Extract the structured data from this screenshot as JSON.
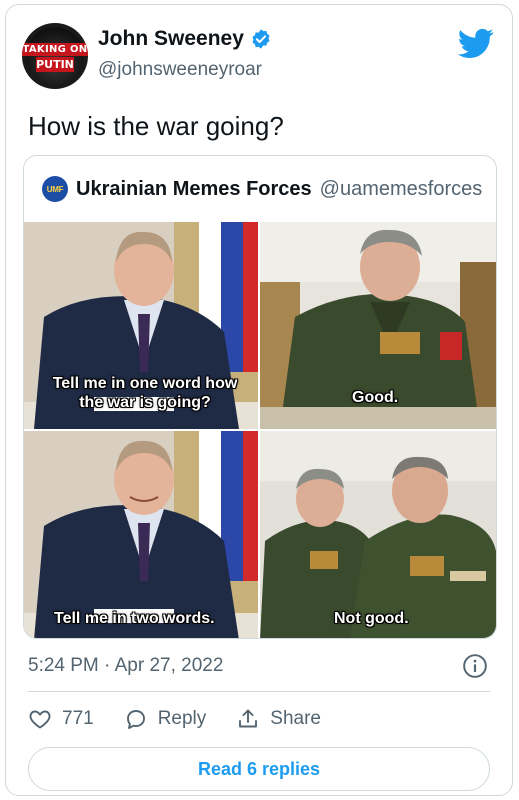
{
  "author": {
    "name": "John Sweeney",
    "handle": "@johnsweeneyroar",
    "avatar_text_line1": "TAKING ON",
    "avatar_text_line2": "PUTIN",
    "verified": true
  },
  "tweet": {
    "text": "How is the war going?",
    "timestamp": "5:24 PM · Apr 27, 2022"
  },
  "quoted": {
    "name": "Ukrainian Memes Forces",
    "handle": "@uamemesforces",
    "avatar_text": "UMF",
    "meme": {
      "top_left_caption": "Tell me in one word how the war is going?",
      "top_right_caption": "Good.",
      "bottom_left_caption": "Tell me in two words.",
      "bottom_right_caption": "Not good."
    }
  },
  "engagement": {
    "likes": "771",
    "reply_label": "Reply",
    "share_label": "Share"
  },
  "read_replies_label": "Read 6 replies",
  "colors": {
    "twitter_blue": "#1d9bf0",
    "text_primary": "#0f1419",
    "text_secondary": "#536471",
    "border": "#cfd9de"
  },
  "icons": [
    "verified-badge-icon",
    "twitter-bird-icon",
    "info-icon",
    "heart-icon",
    "reply-bubble-icon",
    "share-icon"
  ]
}
